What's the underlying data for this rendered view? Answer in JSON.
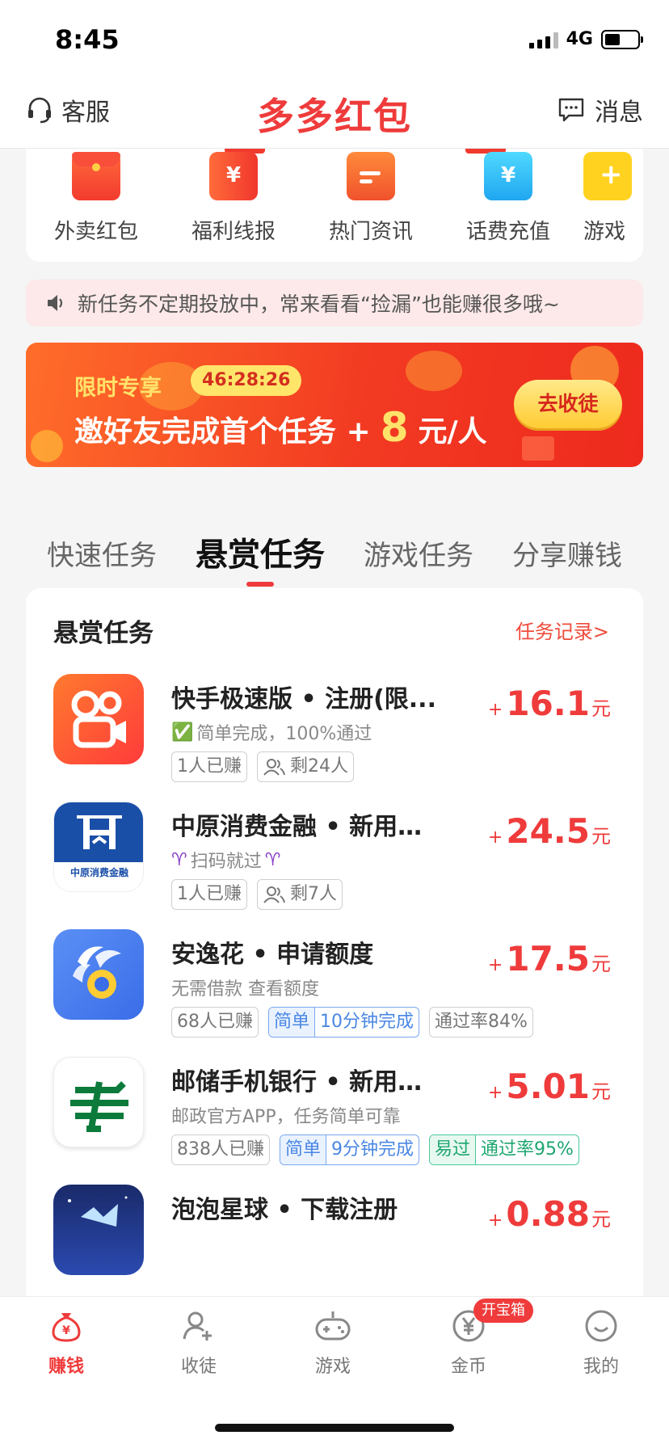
{
  "status_bar": {
    "time": "8:45",
    "network": "4G"
  },
  "header": {
    "service_label": "客服",
    "title": "多多红包",
    "message_label": "消息"
  },
  "quick_menu": [
    {
      "label": "外卖红包",
      "icon": "red-envelope-icon"
    },
    {
      "label": "福利线报",
      "icon": "coupon-ticket-icon"
    },
    {
      "label": "热门资讯",
      "icon": "news-icon"
    },
    {
      "label": "话费充值",
      "icon": "phone-recharge-icon"
    },
    {
      "label": "游戏",
      "icon": "game-plus-icon"
    }
  ],
  "notice": {
    "text": "新任务不定期投放中，常来看看“捡漏”也能赚很多哦~"
  },
  "banner": {
    "tag": "限时专享",
    "timer": "46:28:26",
    "text_before": "邀好友完成首个任务 +",
    "amount": "8",
    "text_after": "元/人",
    "button": "去收徒"
  },
  "tabs": [
    {
      "label": "快速任务"
    },
    {
      "label": "悬赏任务"
    },
    {
      "label": "游戏任务"
    },
    {
      "label": "分享赚钱"
    }
  ],
  "task_section": {
    "title": "悬赏任务",
    "record_link": "任务记录>"
  },
  "tasks": [
    {
      "title": "快手极速版 • 注册(限...",
      "subtitle": "简单完成，100%通过",
      "sub_emoji": "✅",
      "earned": "1人已赚",
      "remaining": "剩24人",
      "reward": "16.1",
      "unit": "元"
    },
    {
      "title": "中原消费金融 • 新用户...",
      "subtitle": "扫码就过",
      "sub_emoji": "♈",
      "earned": "1人已赚",
      "remaining": "剩7人",
      "reward": "24.5",
      "unit": "元",
      "logo_text": "中原消费金融"
    },
    {
      "title": "安逸花 • 申请额度",
      "subtitle": "无需借款 查看额度",
      "earned": "68人已赚",
      "tag_a": "简单",
      "tag_b": "10分钟完成",
      "tag_c": "通过率84%",
      "reward": "17.5",
      "unit": "元"
    },
    {
      "title": "邮储手机银行 • 新用户...",
      "subtitle": "邮政官方APP，任务简单可靠",
      "earned": "838人已赚",
      "tag_a": "简单",
      "tag_b": "9分钟完成",
      "tag_c": "易过",
      "tag_d": "通过率95%",
      "reward": "5.01",
      "unit": "元"
    },
    {
      "title": "泡泡星球 • 下载注册",
      "reward": "0.88",
      "unit": "元"
    }
  ],
  "bottom_nav": [
    {
      "label": "赚钱",
      "icon": "money-bag-icon",
      "active": true
    },
    {
      "label": "收徒",
      "icon": "add-user-icon"
    },
    {
      "label": "游戏",
      "icon": "gamepad-icon"
    },
    {
      "label": "金币",
      "icon": "yen-coin-icon",
      "badge": "开宝箱"
    },
    {
      "label": "我的",
      "icon": "smiley-icon"
    }
  ],
  "colors": {
    "brand_red": "#ef3b3b",
    "banner_gold": "#ffe26a"
  }
}
